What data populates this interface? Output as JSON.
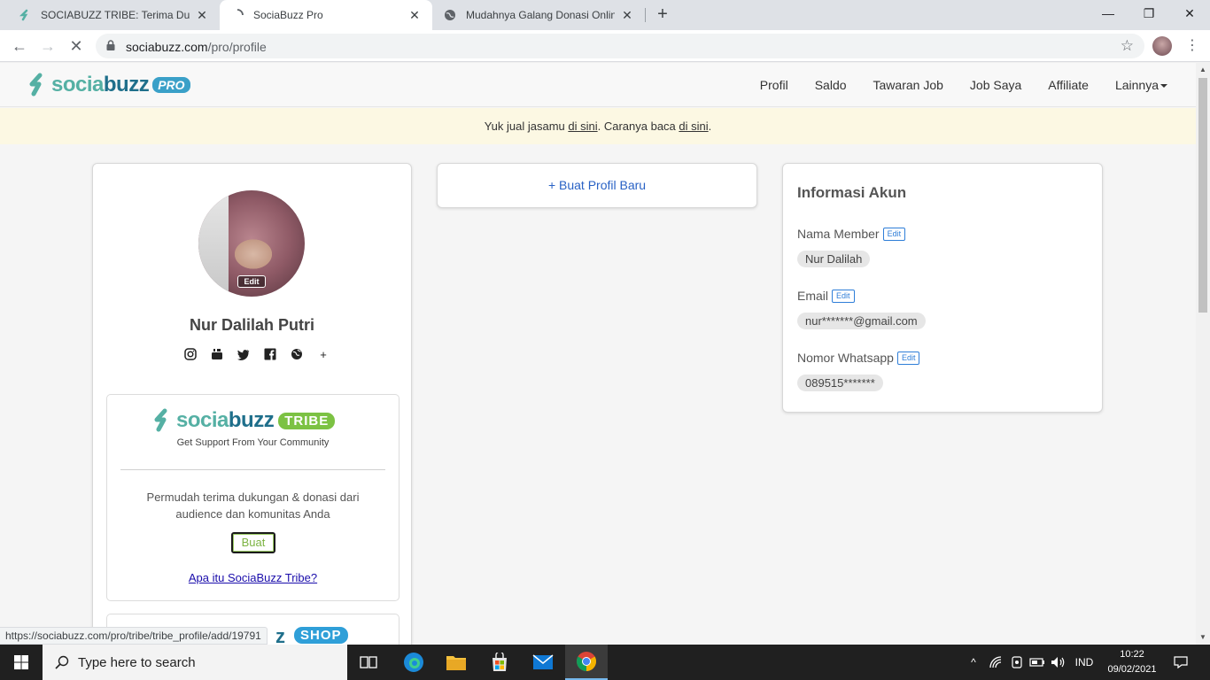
{
  "browser": {
    "tabs": [
      {
        "title": "SOCIABUZZ TRIBE: Terima Dukungan",
        "active": false
      },
      {
        "title": "SociaBuzz Pro",
        "active": true
      },
      {
        "title": "Mudahnya Galang Donasi Online",
        "active": false
      }
    ],
    "new_tab": "+",
    "url_host": "sociabuzz.com",
    "url_path": "/pro/profile",
    "status_url": "https://sociabuzz.com/pro/tribe/tribe_profile/add/19791"
  },
  "site": {
    "logo_word_1": "socia",
    "logo_word_2": "buzz",
    "logo_badge": "PRO",
    "nav": [
      "Profil",
      "Saldo",
      "Tawaran Job",
      "Job Saya",
      "Affiliate",
      "Lainnya"
    ],
    "banner": {
      "text_1": "Yuk jual jasamu ",
      "link_1": "di sini",
      "text_2": ". Caranya baca ",
      "link_2": "di sini",
      "text_3": "."
    }
  },
  "profile": {
    "photo_edit": "Edit",
    "name": "Nur Dalilah Putri",
    "social_icons": [
      "instagram-icon",
      "youtube-icon",
      "twitter-icon",
      "facebook-icon",
      "globe-icon",
      "plus-icon"
    ],
    "tribe": {
      "logo_word_1": "socia",
      "logo_word_2": "buzz",
      "badge": "TRIBE",
      "subtitle": "Get Support From Your Community",
      "description": "Permudah terima dukungan & donasi dari audience dan komunitas Anda",
      "button": "Buat",
      "link": "Apa itu SociaBuzz Tribe?"
    },
    "shop": {
      "badge": "SHOP",
      "fragment": "z"
    }
  },
  "new_profile": {
    "label": "+ Buat Profil Baru"
  },
  "account": {
    "title": "Informasi Akun",
    "edit": "Edit",
    "fields": [
      {
        "label": "Nama Member",
        "value": "Nur Dalilah"
      },
      {
        "label": "Email",
        "value": "nur*******@gmail.com"
      },
      {
        "label": "Nomor Whatsapp",
        "value": "089515*******"
      }
    ]
  },
  "taskbar": {
    "search_placeholder": "Type here to search",
    "language": "IND",
    "time": "10:22",
    "date": "09/02/2021"
  },
  "colors": {
    "brand_teal": "#55b0a4",
    "brand_dark": "#1f6f8b",
    "tribe_green": "#7cc243",
    "link_blue": "#2962c5",
    "banner_bg": "#fcf8e3"
  }
}
